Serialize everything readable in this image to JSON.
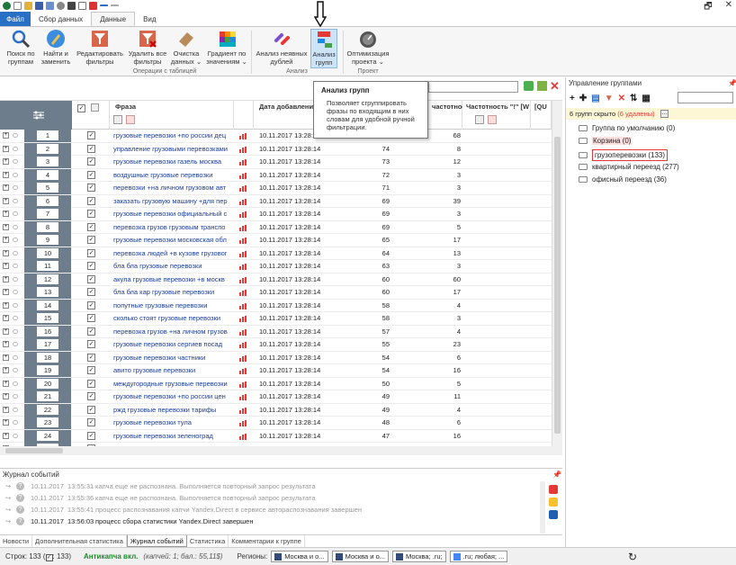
{
  "window": {
    "restore": "🗗",
    "close": "✕"
  },
  "tabs": [
    {
      "label": "Файл"
    },
    {
      "label": "Сбор данных"
    },
    {
      "label": "Данные"
    },
    {
      "label": "Вид"
    }
  ],
  "ribbon": {
    "buttons": [
      {
        "label": "Поиск по\nгруппам"
      },
      {
        "label": "Найти и\nзаменить"
      },
      {
        "label": "Редактировать\nфильтры"
      },
      {
        "label": "Удалить все\nфильтры"
      },
      {
        "label": "Очистка\nданных ⌄"
      },
      {
        "label": "Градиент по\nзначениям ⌄"
      },
      {
        "label": "Анализ неявных\nдублей"
      },
      {
        "label": "Анализ\nгрупп"
      },
      {
        "label": "Оптимизация\nпроекта ⌄"
      }
    ],
    "groups": [
      "Операции с таблицей",
      "Анализ",
      "Проект"
    ]
  },
  "tooltip": {
    "title": "Анализ групп",
    "text": "Позволяет сгруппировать фразы по входящим в них словам для удобной ручной фильтрации."
  },
  "grid": {
    "headers": {
      "phrase": "Фраза",
      "date": "Дата добавления",
      "freq1": "частотность \" \" [W",
      "freq2": "Частотность \"!\" [W",
      "qu": "[QU"
    },
    "rows": [
      {
        "n": "1",
        "phrase": "грузовые перевозки +по россии дец",
        "date": "10.11.2017 13:28:14",
        "v1": "",
        "v2": "68"
      },
      {
        "n": "2",
        "phrase": "управление грузовыми перевозками",
        "date": "10.11.2017 13:28:14",
        "v1": "74",
        "v2": "8"
      },
      {
        "n": "3",
        "phrase": "грузовые перевозки газель москва",
        "date": "10.11.2017 13:28:14",
        "v1": "73",
        "v2": "12"
      },
      {
        "n": "4",
        "phrase": "воздушные грузовые перевозки",
        "date": "10.11.2017 13:28:14",
        "v1": "72",
        "v2": "3"
      },
      {
        "n": "5",
        "phrase": "перевозки +на личном грузовом авт",
        "date": "10.11.2017 13:28:14",
        "v1": "71",
        "v2": "3"
      },
      {
        "n": "6",
        "phrase": "заказать грузовую машину +для пер",
        "date": "10.11.2017 13:28:14",
        "v1": "69",
        "v2": "39"
      },
      {
        "n": "7",
        "phrase": "грузовые перевозки официальный с",
        "date": "10.11.2017 13:28:14",
        "v1": "69",
        "v2": "3"
      },
      {
        "n": "8",
        "phrase": "перевозка грузов грузовым транспо",
        "date": "10.11.2017 13:28:14",
        "v1": "69",
        "v2": "5"
      },
      {
        "n": "9",
        "phrase": "грузовые перевозки московская обл",
        "date": "10.11.2017 13:28:14",
        "v1": "65",
        "v2": "17"
      },
      {
        "n": "10",
        "phrase": "перевозка людей +в кузове грузовог",
        "date": "10.11.2017 13:28:14",
        "v1": "64",
        "v2": "13"
      },
      {
        "n": "11",
        "phrase": "бла бла грузовые перевозки",
        "date": "10.11.2017 13:28:14",
        "v1": "63",
        "v2": "3"
      },
      {
        "n": "12",
        "phrase": "акула грузовые перевозки +в москв",
        "date": "10.11.2017 13:28:14",
        "v1": "60",
        "v2": "60"
      },
      {
        "n": "13",
        "phrase": "бла бла кар грузовые перевозки",
        "date": "10.11.2017 13:28:14",
        "v1": "60",
        "v2": "17"
      },
      {
        "n": "14",
        "phrase": "попутные грузовые перевозки",
        "date": "10.11.2017 13:28:14",
        "v1": "58",
        "v2": "4"
      },
      {
        "n": "15",
        "phrase": "сколько стоят грузовые перевозки",
        "date": "10.11.2017 13:28:14",
        "v1": "58",
        "v2": "3"
      },
      {
        "n": "16",
        "phrase": "перевозка грузов +на личном грузов",
        "date": "10.11.2017 13:28:14",
        "v1": "57",
        "v2": "4"
      },
      {
        "n": "17",
        "phrase": "грузовые перевозки сергиев посад",
        "date": "10.11.2017 13:28:14",
        "v1": "55",
        "v2": "23"
      },
      {
        "n": "18",
        "phrase": "грузовые перевозки частники",
        "date": "10.11.2017 13:28:14",
        "v1": "54",
        "v2": "6"
      },
      {
        "n": "19",
        "phrase": "авито грузовые перевозки",
        "date": "10.11.2017 13:28:14",
        "v1": "54",
        "v2": "16"
      },
      {
        "n": "20",
        "phrase": "междугородные грузовые перевозки",
        "date": "10.11.2017 13:28:14",
        "v1": "50",
        "v2": "5"
      },
      {
        "n": "21",
        "phrase": "грузовые перевозки +по россии цен",
        "date": "10.11.2017 13:28:14",
        "v1": "49",
        "v2": "11"
      },
      {
        "n": "22",
        "phrase": "ржд грузовые перевозки тарифы",
        "date": "10.11.2017 13:28:14",
        "v1": "49",
        "v2": "4"
      },
      {
        "n": "23",
        "phrase": "грузовые перевозки тула",
        "date": "10.11.2017 13:28:14",
        "v1": "48",
        "v2": "6"
      },
      {
        "n": "24",
        "phrase": "грузовые перевозки зеленоград",
        "date": "10.11.2017 13:28:14",
        "v1": "47",
        "v2": "16"
      },
      {
        "n": "25",
        "phrase": "грузовые перевозки окекза 2017",
        "date": "10.11.2017 13:28:14",
        "v1": "46",
        "v2": "17"
      }
    ]
  },
  "log": {
    "title": "Журнал событий",
    "entries": [
      {
        "date": "10.11.2017",
        "time": "13:55:31",
        "msg": "капча еще не распознана. Выполняется повторный запрос результата"
      },
      {
        "date": "10.11.2017",
        "time": "13:55:36",
        "msg": "капча еще не распознана. Выполняется повторный запрос результата"
      },
      {
        "date": "10.11.2017",
        "time": "13:55:41",
        "msg": "процесс распознавания капчи Yandex.Direct в сервисе автораспознавания завершен"
      },
      {
        "date": "10.11.2017",
        "time": "13:56:03",
        "msg": "процесс сбора статистики Yandex.Direct завершен"
      }
    ]
  },
  "bottom_tabs": [
    "Новости",
    "Дополнительная статистика",
    "Журнал событий",
    "Статистика",
    "Комментарии к группе"
  ],
  "groups_panel": {
    "title": "Управление группами",
    "hidden_prefix": "6 групп скрыто ",
    "hidden_deleted": "(6 удалены)",
    "items": [
      {
        "label": "Группа по умолчанию (0)"
      },
      {
        "label": "Корзина (0)"
      },
      {
        "label": "грузоперевозки (133)"
      },
      {
        "label": "квартирный переезд (277)"
      },
      {
        "label": "офисный переезд (36)"
      }
    ]
  },
  "status": {
    "rows": "Строк: 133 (",
    "rows_checked": ": 133)",
    "anticaptcha": "Антикапча вкл.",
    "anticaptcha_info": "(капчей: 1; бал.: 55,11$)",
    "regions_label": "Регионы:",
    "regions": [
      "Москва и о...",
      "Москва и о...",
      "Москва; .ru;",
      ".ru; любая; ..."
    ]
  },
  "colors": {
    "accent": "#2a6fc6",
    "grid_side": "#6d7d8c",
    "link": "#1a3c9c",
    "highlight": "#e53935"
  }
}
